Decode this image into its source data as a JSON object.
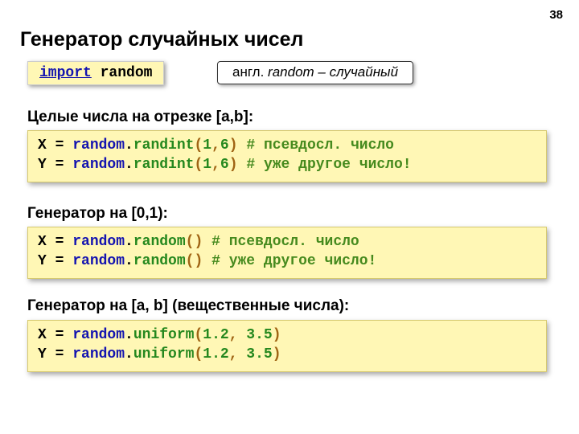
{
  "page_number": "38",
  "title": "Генератор случайных чисел",
  "import_kw": "import",
  "import_mod": "random",
  "note_prefix": "англ.",
  "note_word": "random",
  "note_dash": " – ",
  "note_trans": "случайный",
  "sections": {
    "s1": "Целые числа на отрезке [a,b]:",
    "s2": "Генератор на [0,1):",
    "s3": "Генератор на [a, b] (вещественные числа):"
  },
  "t": {
    "Xeq": "X = ",
    "Yeq": "Y = ",
    "random": "random",
    "dot": ".",
    "randint": "randint",
    "randomfn": "random",
    "uniform": "uniform",
    "lp": "(",
    "rp": ")",
    "comma": ",",
    "one": "1",
    "six": "6",
    "v12": "1.2",
    "v35": "3.5",
    "sp": " ",
    "cmt1": "# псевдосл. число",
    "cmt2": "# уже другое число!",
    "sp3": "   ",
    "space2": ", "
  }
}
